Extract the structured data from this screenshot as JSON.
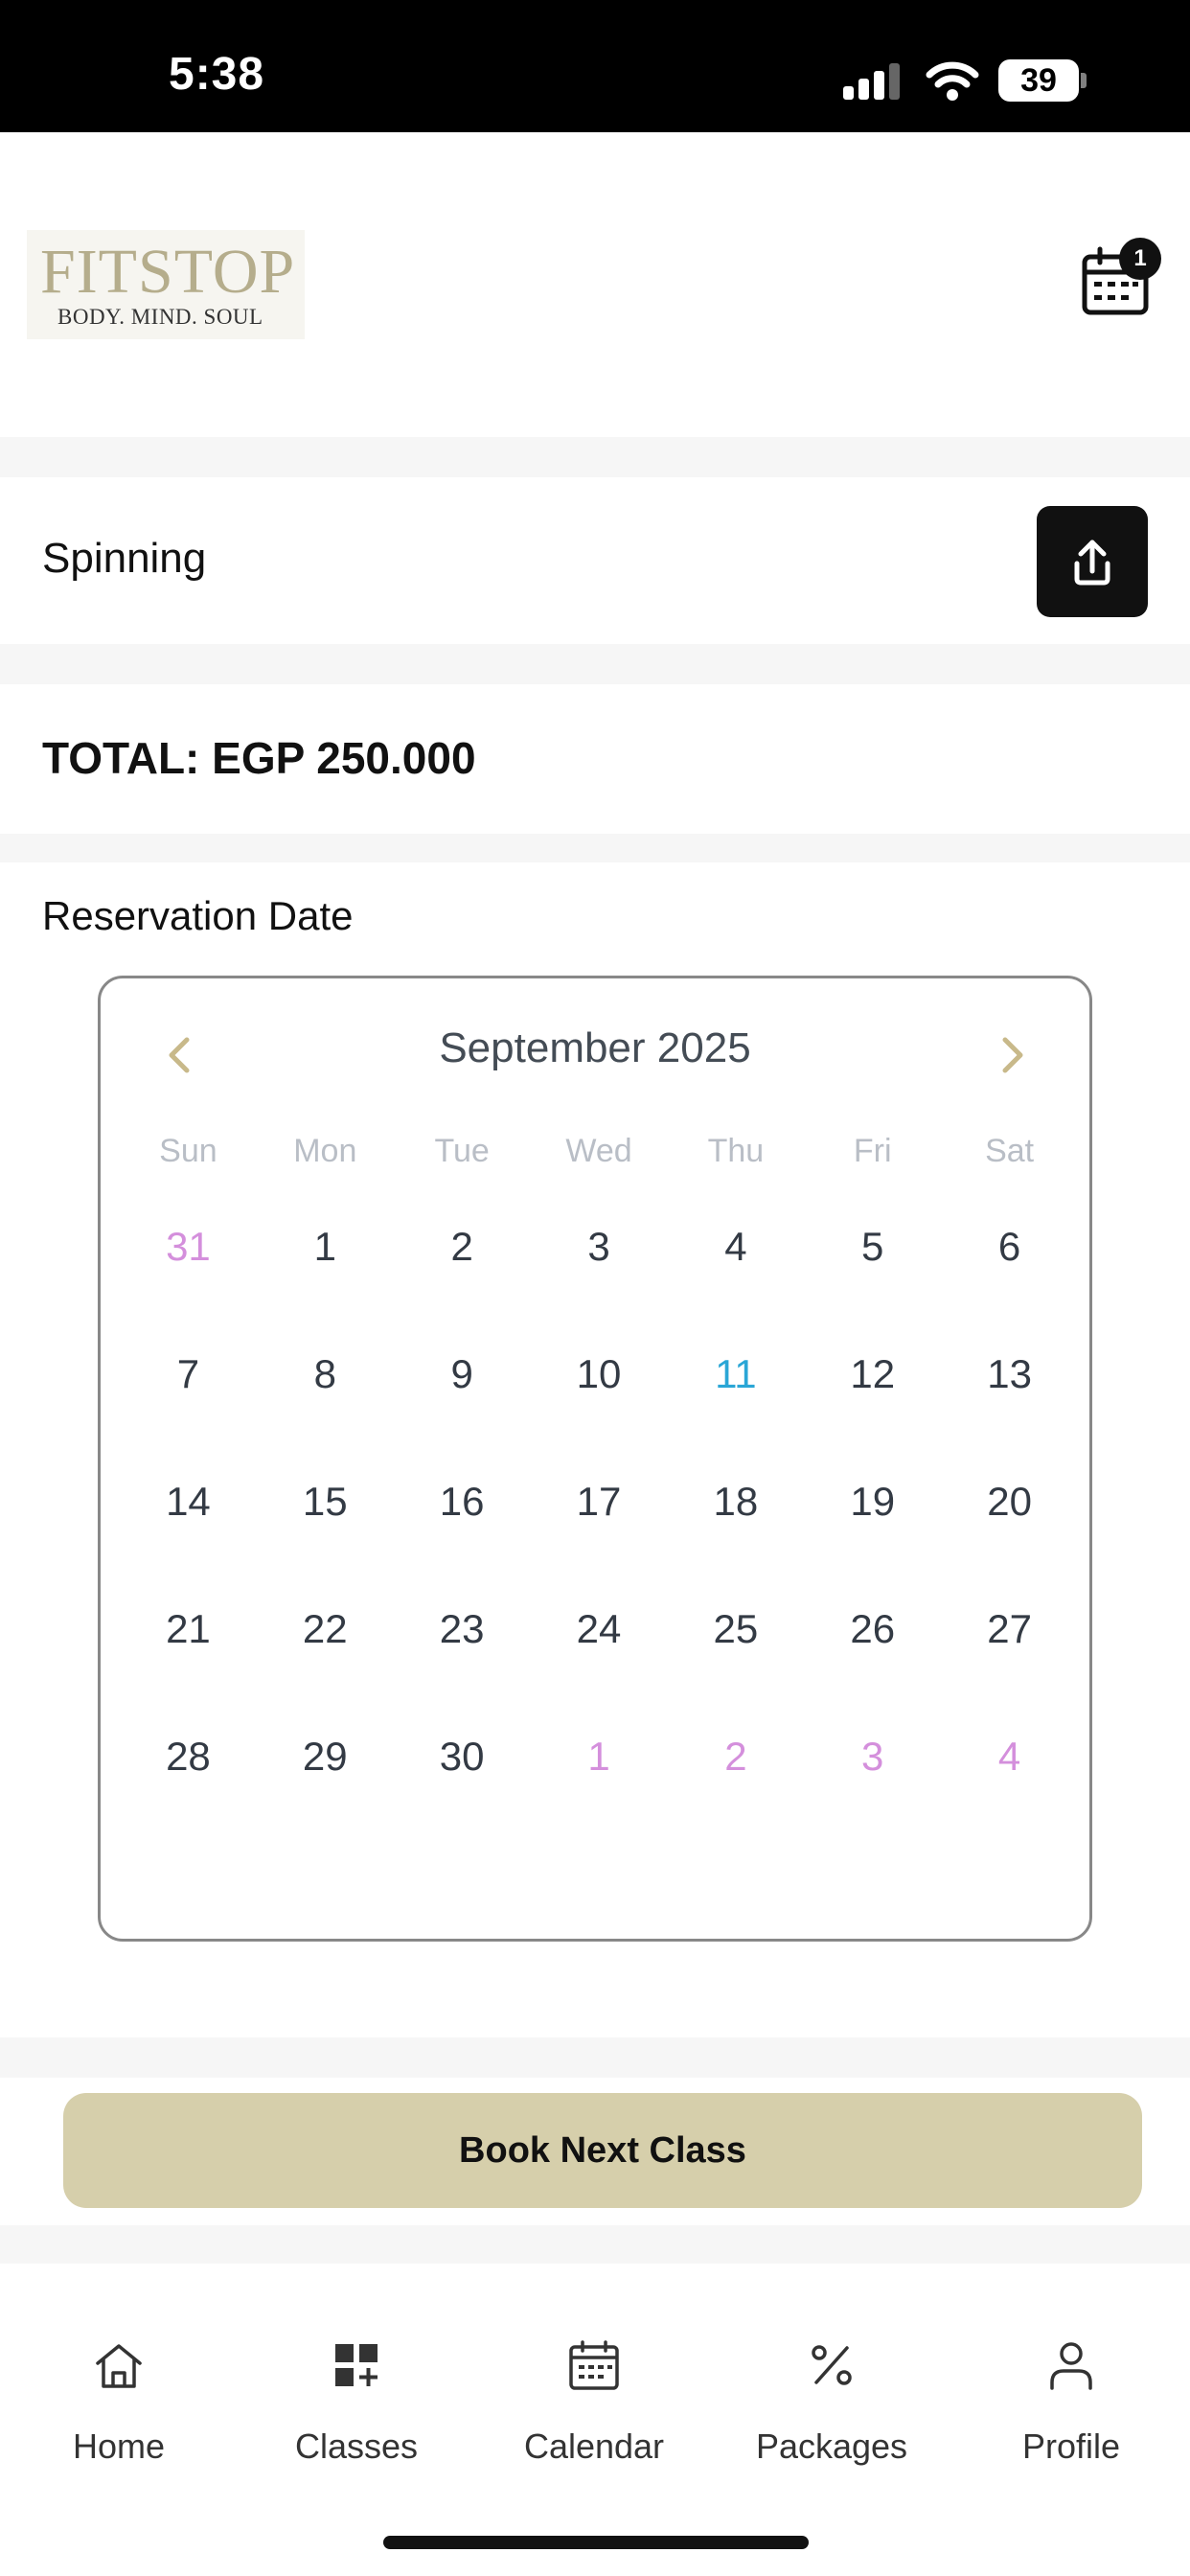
{
  "status_bar": {
    "time": "5:38",
    "battery": "39"
  },
  "header": {
    "logo_title": "FITSTOP",
    "logo_subtitle": "BODY. MIND. SOUL",
    "calendar_badge": "1"
  },
  "class": {
    "name": "Spinning"
  },
  "total": {
    "label": "TOTAL: EGP 250.000"
  },
  "reservation": {
    "label": "Reservation Date"
  },
  "calendar": {
    "month_label": "September 2025",
    "weekdays": [
      "Sun",
      "Mon",
      "Tue",
      "Wed",
      "Thu",
      "Fri",
      "Sat"
    ],
    "weeks": [
      [
        "31",
        "1",
        "2",
        "3",
        "4",
        "5",
        "6"
      ],
      [
        "7",
        "8",
        "9",
        "10",
        "11",
        "12",
        "13"
      ],
      [
        "14",
        "15",
        "16",
        "17",
        "18",
        "19",
        "20"
      ],
      [
        "21",
        "22",
        "23",
        "24",
        "25",
        "26",
        "27"
      ],
      [
        "28",
        "29",
        "30",
        "1",
        "2",
        "3",
        "4"
      ]
    ],
    "today": "11",
    "colors": {
      "outside_month": "#d48fdc",
      "today": "#2aa6d6",
      "nav_arrow": "#c8b98a"
    }
  },
  "book_button": {
    "label": "Book Next Class",
    "color": "#d6cfab"
  },
  "tabs": [
    {
      "label": "Home",
      "icon": "home-icon"
    },
    {
      "label": "Classes",
      "icon": "classes-grid-icon"
    },
    {
      "label": "Calendar",
      "icon": "calendar-icon"
    },
    {
      "label": "Packages",
      "icon": "percent-icon"
    },
    {
      "label": "Profile",
      "icon": "profile-icon"
    }
  ]
}
